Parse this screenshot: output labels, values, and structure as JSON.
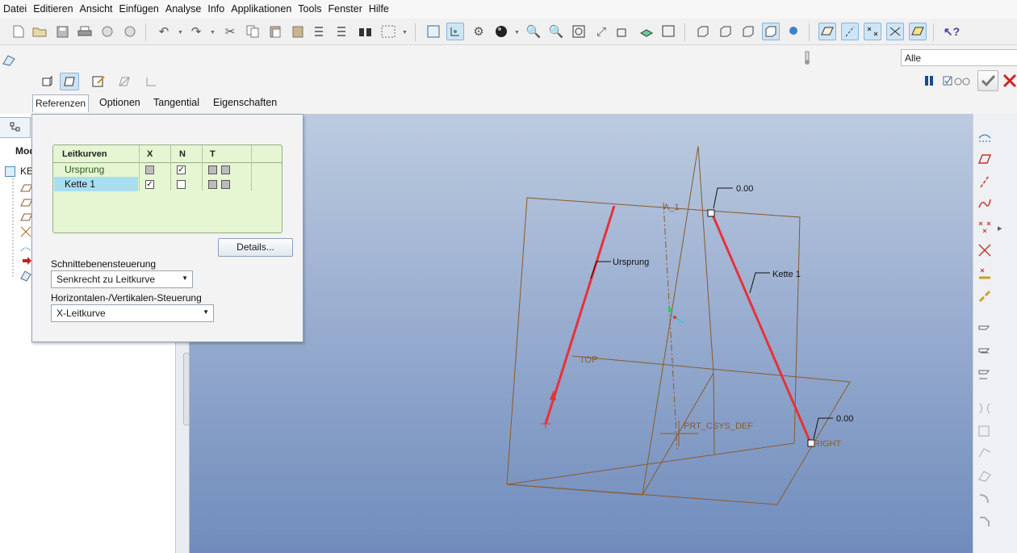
{
  "menu": [
    "Datei",
    "Editieren",
    "Ansicht",
    "Einfügen",
    "Analyse",
    "Info",
    "Applikationen",
    "Tools",
    "Fenster",
    "Hilfe"
  ],
  "filter": {
    "value": "Alle"
  },
  "dashboard": {
    "tabs": [
      "Referenzen",
      "Optionen",
      "Tangential",
      "Eigenschaften"
    ],
    "active_tab": "Referenzen"
  },
  "left_panel": {
    "tab_label": "Mod",
    "root_label": "KE"
  },
  "references_panel": {
    "table": {
      "headers": [
        "Leitkurven",
        "X",
        "N",
        "T"
      ],
      "rows": [
        {
          "name": "Ursprung",
          "x": "grey",
          "n": true,
          "t": true,
          "selected": false
        },
        {
          "name": "Kette 1",
          "x": true,
          "n": false,
          "t": true,
          "selected": true
        }
      ]
    },
    "details_button": "Details...",
    "section_control_label": "Schnittebenensteuerung",
    "section_control_value": "Senkrecht zu Leitkurve",
    "hv_control_label": "Horizontalen-/Vertikalen-Steuerung",
    "hv_control_value": "X-Leitkurve"
  },
  "viewport": {
    "labels": {
      "ursprung": "Ursprung",
      "kette": "Kette 1",
      "value_top": "0.00",
      "value_bottom": "0.00",
      "plane_top": "TOP",
      "plane_right": "RIGHT",
      "csys": "PRT_CSYS_DEF",
      "axis": "A_1"
    },
    "colors": {
      "background_top": "#bccbe0",
      "background_bottom": "#6f8cbc",
      "datum": "#8a5a2b",
      "trajectory": "#e8313a"
    }
  }
}
